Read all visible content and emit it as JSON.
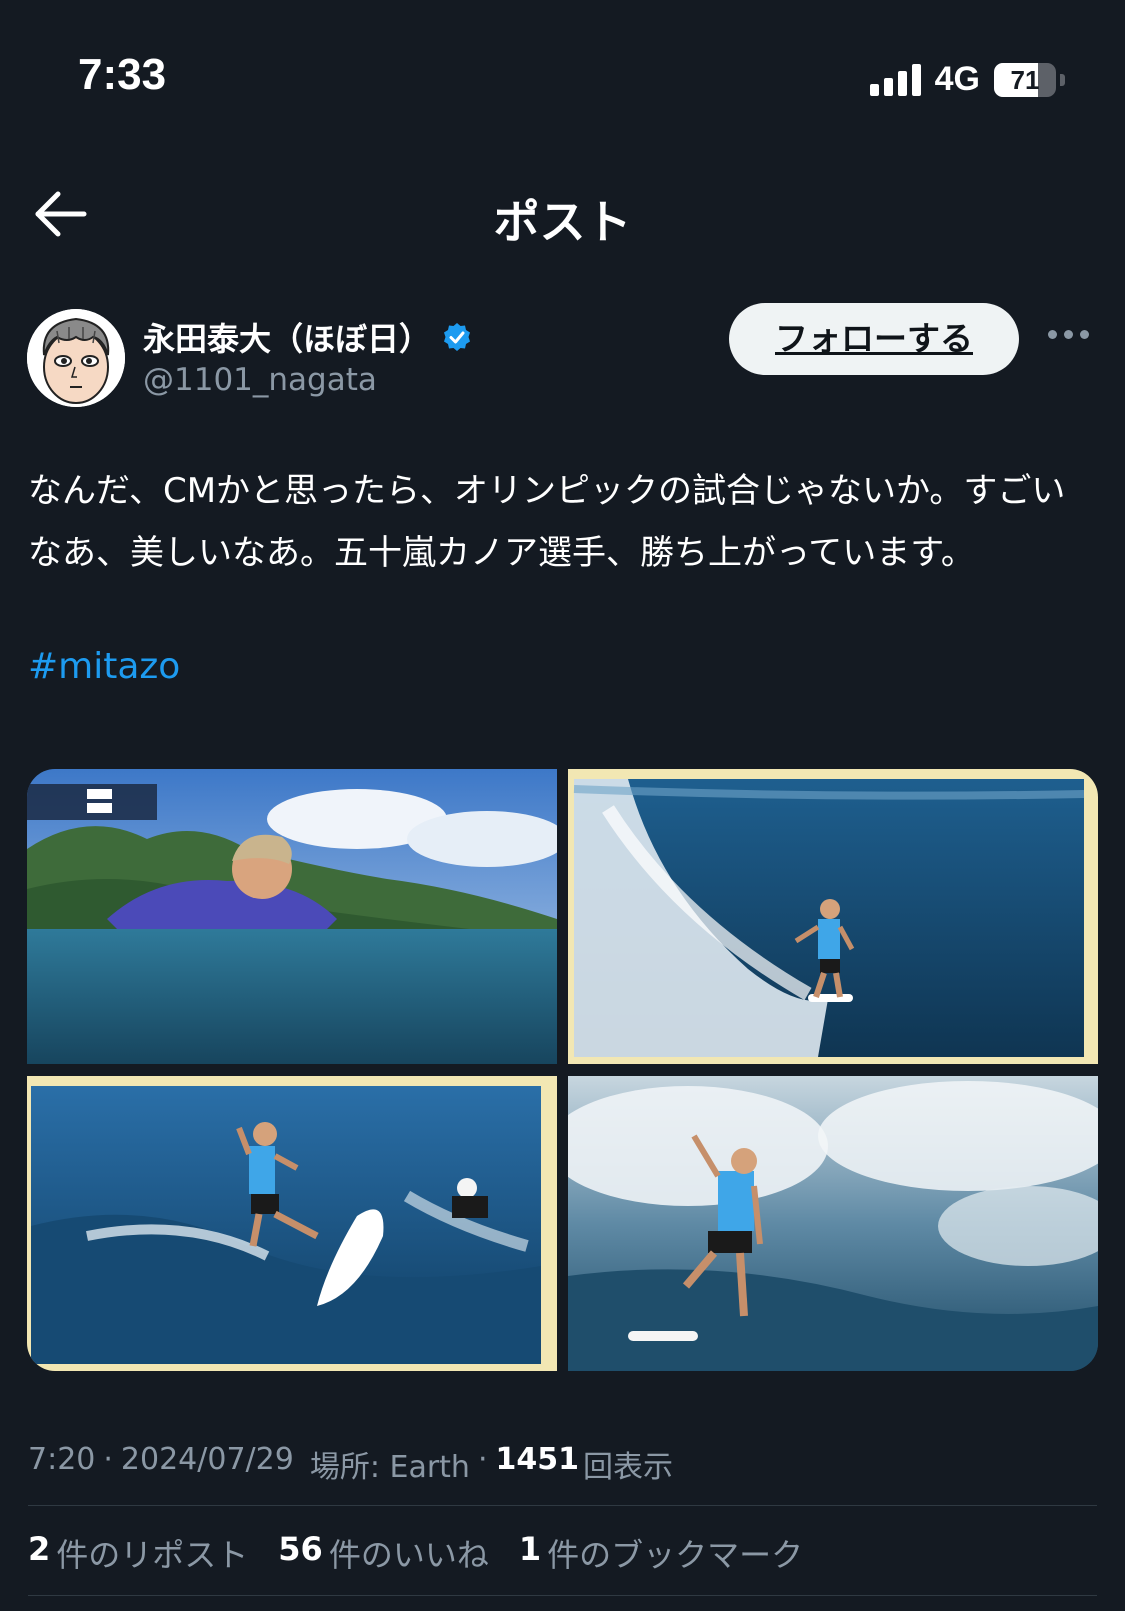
{
  "status_bar": {
    "time": "7:33",
    "network": "4G",
    "battery_percent": "71",
    "battery_level": 0.71
  },
  "nav": {
    "back_icon": "arrow-left-icon",
    "title": "ポスト"
  },
  "author": {
    "name": "永田泰大（ほぼ日）",
    "handle": "@1101_nagata",
    "verified_icon": "verified-badge-icon",
    "verified_color": "#1d9bf0"
  },
  "follow_button": {
    "label": "フォローする"
  },
  "more_icon": "more-horizontal-icon",
  "post": {
    "text": "なんだ、CMかと思ったら、オリンピックの試合じゃないか。すごいなあ、美しいなあ。五十嵐カノア選手、勝ち上がっています。",
    "hashtag": "#mitazo"
  },
  "meta": {
    "time": "7:20",
    "date": "2024/07/29",
    "location_label": "場所: Earth",
    "views_count": "1451",
    "views_label": "回表示",
    "separator": "·"
  },
  "stats": [
    {
      "count": "2",
      "label": "件のリポスト"
    },
    {
      "count": "56",
      "label": "件のいいね"
    },
    {
      "count": "1",
      "label": "件のブックマーク"
    }
  ],
  "colors": {
    "background": "#141a22",
    "link": "#1d9bf0",
    "secondary_text": "#8b98a5"
  }
}
